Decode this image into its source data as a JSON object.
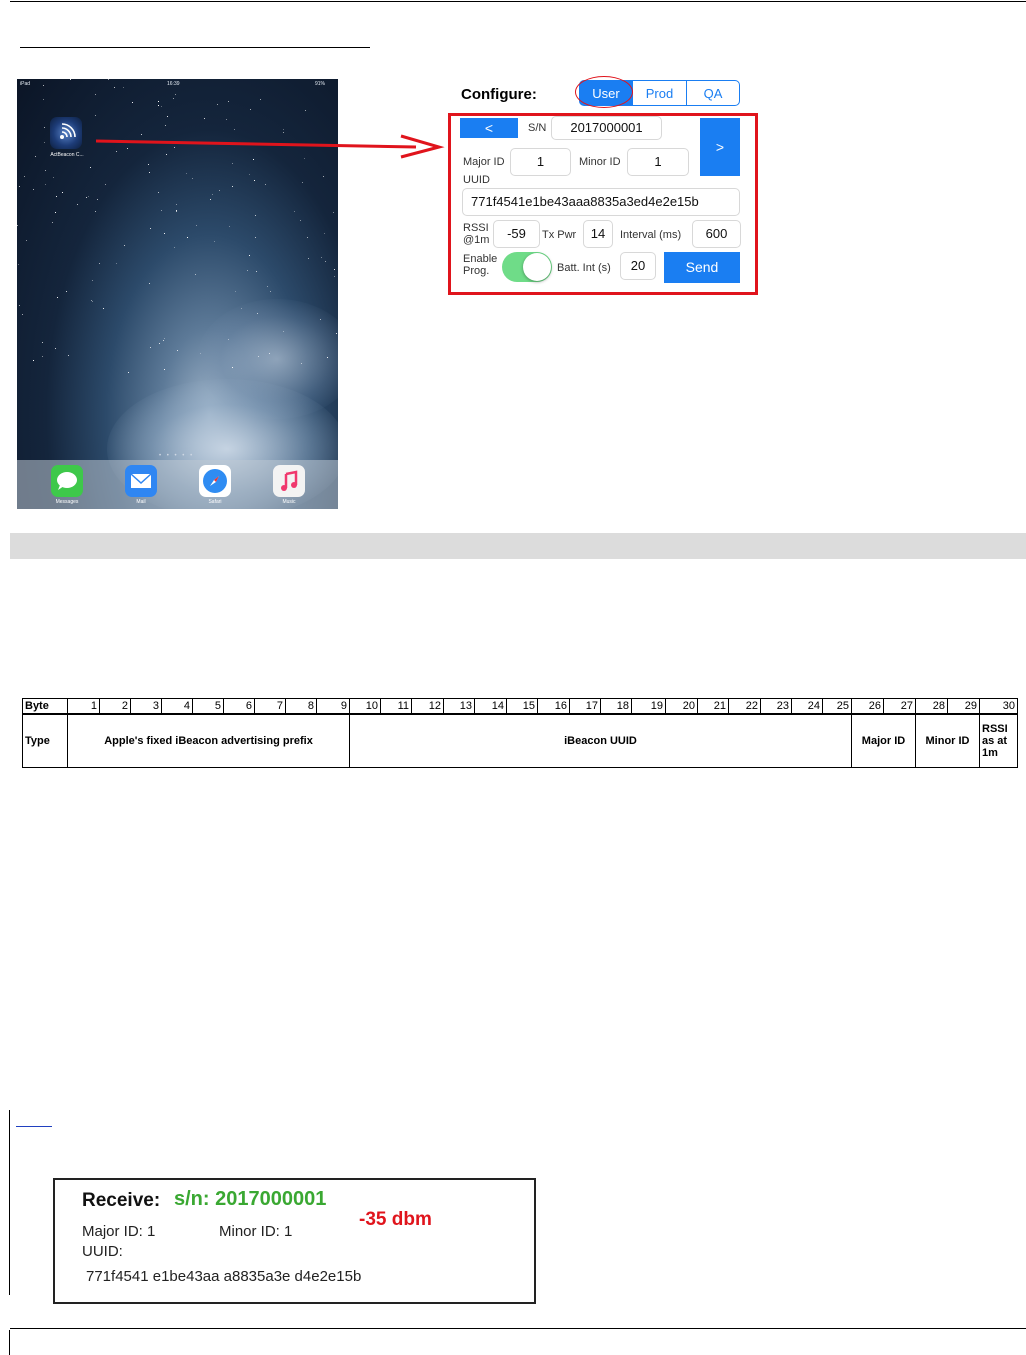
{
  "ipad": {
    "status_left": "iPad",
    "status_time": "16:39",
    "status_right": "91%",
    "app_label": "ActBeacon C...",
    "dock": [
      {
        "label": "Messages",
        "icon": "messages-icon",
        "color": "#3ec84a"
      },
      {
        "label": "Mail",
        "icon": "mail-icon",
        "color": "#2f86f2"
      },
      {
        "label": "Safari",
        "icon": "safari-icon",
        "color": "#2f8cf2"
      },
      {
        "label": "Music",
        "icon": "music-icon",
        "color": "#f3f3f3"
      }
    ]
  },
  "configure": {
    "title": "Configure:",
    "modes": [
      "User",
      "Prod",
      "QA"
    ],
    "selected_mode": "User",
    "prev_label": "<",
    "next_label": ">",
    "sn_label": "S/N",
    "sn_value": "2017000001",
    "major_label": "Major ID",
    "major_value": "1",
    "minor_label": "Minor ID",
    "minor_value": "1",
    "uuid_label": "UUID",
    "uuid_value": "771f4541e1be43aaa8835a3ed4e2e15b",
    "rssi_label_1": "RSSI",
    "rssi_label_2": "@1m",
    "rssi_value": "-59",
    "txpwr_label": "Tx Pwr",
    "txpwr_value": "14",
    "interval_label": "Interval (ms)",
    "interval_value": "600",
    "enable_label_1": "Enable",
    "enable_label_2": "Prog.",
    "enable_on": true,
    "batt_label": "Batt. Int (s)",
    "batt_value": "20",
    "send_label": "Send"
  },
  "byte_table": {
    "header_label": "Byte",
    "type_label": "Type",
    "bytes": [
      "1",
      "2",
      "3",
      "4",
      "5",
      "6",
      "7",
      "8",
      "9",
      "10",
      "11",
      "12",
      "13",
      "14",
      "15",
      "16",
      "17",
      "18",
      "19",
      "20",
      "21",
      "22",
      "23",
      "24",
      "25",
      "26",
      "27",
      "28",
      "29",
      "30"
    ],
    "fields": [
      {
        "label": "Apple's fixed iBeacon advertising prefix",
        "from": 1,
        "to": 9
      },
      {
        "label": "iBeacon UUID",
        "from": 10,
        "to": 25
      },
      {
        "label": "Major ID",
        "from": 26,
        "to": 27
      },
      {
        "label": "Minor ID",
        "from": 28,
        "to": 29
      },
      {
        "label": "RSSI as at 1m",
        "from": 30,
        "to": 30
      }
    ]
  },
  "receive": {
    "title": "Receive:",
    "sn": "s/n: 2017000001",
    "dbm": "-35 dbm",
    "major": "Major ID: 1",
    "minor": "Minor ID: 1",
    "uuid_label": "UUID:",
    "uuid_value": "771f4541 e1be43aa a8835a3e d4e2e15b"
  },
  "colors": {
    "ios_blue": "#1a7ef2",
    "red": "#e0141c",
    "green": "#3aa832"
  }
}
